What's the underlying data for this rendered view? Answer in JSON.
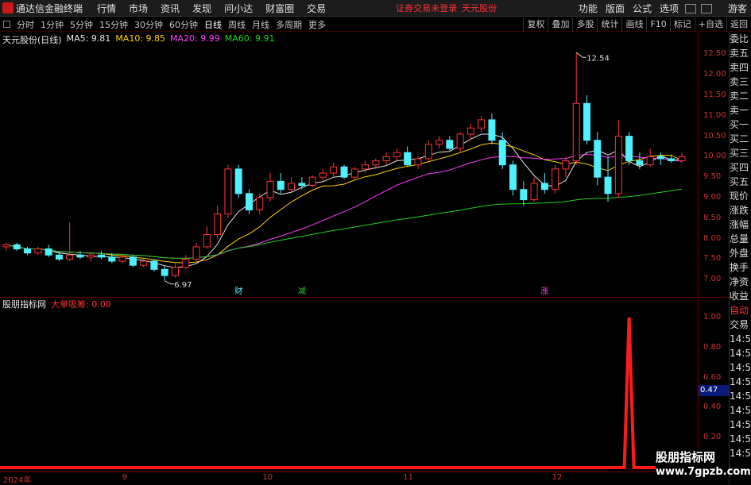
{
  "app": {
    "title": "通达信金融终端"
  },
  "menu": [
    "行情",
    "市场",
    "资讯",
    "发现",
    "问小达",
    "财富圈",
    "交易"
  ],
  "notice": {
    "login": "证券交易未登录",
    "stock": "天元股份"
  },
  "right_menu": [
    "功能",
    "版面",
    "公式",
    "选项"
  ],
  "guest": "游客",
  "periods": [
    "分时",
    "1分钟",
    "5分钟",
    "15分钟",
    "30分钟",
    "60分钟",
    "日线",
    "周线",
    "月线",
    "多周期",
    "更多"
  ],
  "active_period": "日线",
  "tools": [
    "复权",
    "叠加",
    "多股",
    "统计",
    "画线",
    "F10",
    "标记",
    "+自选",
    "返回"
  ],
  "main_legend": {
    "stock": "天元股份(日线)",
    "ma5": "MA5: 9.81",
    "ma10": "MA10: 9.85",
    "ma20": "MA20: 9.99",
    "ma60": "MA60: 9.91"
  },
  "colors": {
    "up": "#ff3232",
    "down": "#4ff0ff",
    "ma5": "#e8e8e8",
    "ma10": "#ffd400",
    "ma20": "#ff3cff",
    "ma60": "#20d020",
    "axis": "#d03030"
  },
  "annotations": {
    "high": "12.54",
    "low": "6.97",
    "marks": [
      "财",
      "减",
      "涨"
    ]
  },
  "y_ticks": [
    "12.50",
    "12.00",
    "11.50",
    "11.00",
    "10.50",
    "10.00",
    "9.50",
    "9.00",
    "8.50",
    "8.00",
    "7.50",
    "7.00"
  ],
  "side_labels": [
    "委比",
    "卖五",
    "卖四",
    "卖三",
    "卖二",
    "卖一",
    "买一",
    "买二",
    "买三",
    "买四",
    "买五",
    "现价",
    "涨跌",
    "涨幅",
    "总量",
    "外盘",
    "换手",
    "净资",
    "收益"
  ],
  "side_bottom": [
    "自动",
    "交易",
    "14:56",
    "14:56",
    "14:56",
    "14:56",
    "14:56",
    "14:56",
    "14:56",
    "14:56",
    "14:56"
  ],
  "sub_legend": {
    "name": "股朋指标网",
    "indicator": "大单吸筹: 0.00"
  },
  "sub_y_ticks": [
    "1.00",
    "0.80",
    "0.60",
    "0.40",
    "0.20"
  ],
  "sub_current": "0.47",
  "x_ticks": [
    "2024年",
    "9",
    "10",
    "11",
    "12",
    "1"
  ],
  "watermark": {
    "line1": "股朋指标网",
    "line2": "www.7gpzb.com"
  },
  "chart_data": {
    "type": "candlestick",
    "title": "天元股份(日线)",
    "ylim": [
      6.85,
      12.7
    ],
    "candles": [
      [
        7.8,
        7.9,
        7.7,
        7.85
      ],
      [
        7.85,
        7.9,
        7.7,
        7.75
      ],
      [
        7.75,
        7.8,
        7.6,
        7.65
      ],
      [
        7.65,
        7.8,
        7.6,
        7.75
      ],
      [
        7.75,
        7.85,
        7.55,
        7.6
      ],
      [
        7.6,
        7.7,
        7.45,
        7.5
      ],
      [
        7.5,
        8.4,
        7.45,
        7.6
      ],
      [
        7.6,
        7.7,
        7.5,
        7.55
      ],
      [
        7.55,
        7.65,
        7.45,
        7.6
      ],
      [
        7.6,
        7.7,
        7.5,
        7.55
      ],
      [
        7.55,
        7.65,
        7.4,
        7.45
      ],
      [
        7.45,
        7.6,
        7.4,
        7.55
      ],
      [
        7.55,
        7.6,
        7.3,
        7.35
      ],
      [
        7.35,
        7.5,
        7.3,
        7.45
      ],
      [
        7.45,
        7.5,
        7.2,
        7.25
      ],
      [
        7.25,
        7.35,
        6.97,
        7.1
      ],
      [
        7.1,
        7.4,
        7.05,
        7.3
      ],
      [
        7.3,
        7.6,
        7.25,
        7.5
      ],
      [
        7.5,
        7.9,
        7.45,
        7.8
      ],
      [
        7.8,
        8.3,
        7.75,
        8.1
      ],
      [
        8.1,
        8.8,
        8.0,
        8.6
      ],
      [
        8.6,
        9.8,
        8.5,
        9.7
      ],
      [
        9.7,
        9.8,
        9.0,
        9.1
      ],
      [
        9.1,
        9.2,
        8.6,
        8.7
      ],
      [
        8.7,
        9.1,
        8.6,
        9.0
      ],
      [
        9.0,
        9.6,
        8.9,
        9.4
      ],
      [
        9.4,
        9.6,
        9.1,
        9.2
      ],
      [
        9.2,
        9.5,
        9.1,
        9.35
      ],
      [
        9.35,
        9.5,
        9.2,
        9.3
      ],
      [
        9.3,
        9.55,
        9.25,
        9.5
      ],
      [
        9.5,
        9.7,
        9.4,
        9.6
      ],
      [
        9.6,
        9.85,
        9.5,
        9.75
      ],
      [
        9.75,
        9.8,
        9.45,
        9.5
      ],
      [
        9.5,
        9.75,
        9.45,
        9.7
      ],
      [
        9.7,
        9.9,
        9.6,
        9.8
      ],
      [
        9.8,
        9.95,
        9.7,
        9.9
      ],
      [
        9.9,
        10.1,
        9.8,
        10.0
      ],
      [
        10.0,
        10.2,
        9.9,
        10.1
      ],
      [
        10.1,
        10.25,
        9.75,
        9.8
      ],
      [
        9.8,
        10.0,
        9.7,
        9.95
      ],
      [
        9.95,
        10.4,
        9.9,
        10.3
      ],
      [
        10.3,
        10.5,
        10.2,
        10.4
      ],
      [
        10.4,
        10.5,
        10.15,
        10.2
      ],
      [
        10.2,
        10.6,
        10.1,
        10.55
      ],
      [
        10.55,
        10.8,
        10.4,
        10.7
      ],
      [
        10.7,
        11.0,
        10.6,
        10.9
      ],
      [
        10.9,
        11.05,
        10.3,
        10.4
      ],
      [
        10.4,
        10.6,
        9.7,
        9.8
      ],
      [
        9.8,
        9.9,
        9.05,
        9.2
      ],
      [
        9.2,
        9.4,
        8.8,
        8.95
      ],
      [
        8.95,
        9.5,
        8.9,
        9.35
      ],
      [
        9.35,
        9.6,
        9.1,
        9.2
      ],
      [
        9.2,
        9.8,
        9.1,
        9.7
      ],
      [
        9.7,
        10.0,
        9.5,
        9.9
      ],
      [
        9.9,
        12.54,
        9.8,
        11.3
      ],
      [
        11.3,
        11.5,
        10.3,
        10.4
      ],
      [
        10.4,
        10.6,
        9.3,
        9.5
      ],
      [
        9.5,
        10.0,
        8.9,
        9.1
      ],
      [
        9.1,
        10.9,
        9.0,
        10.5
      ],
      [
        10.5,
        10.6,
        9.8,
        9.9
      ],
      [
        9.9,
        10.1,
        9.7,
        9.8
      ],
      [
        9.8,
        10.2,
        9.75,
        10.0
      ],
      [
        10.0,
        10.1,
        9.8,
        9.95
      ],
      [
        9.95,
        10.05,
        9.85,
        9.9
      ],
      [
        9.9,
        10.1,
        9.85,
        10.0
      ]
    ],
    "indicator": {
      "name": "大单吸筹",
      "ylim": [
        0,
        1.1
      ],
      "spike_at_index": 59,
      "spike_value": 1.0
    }
  }
}
